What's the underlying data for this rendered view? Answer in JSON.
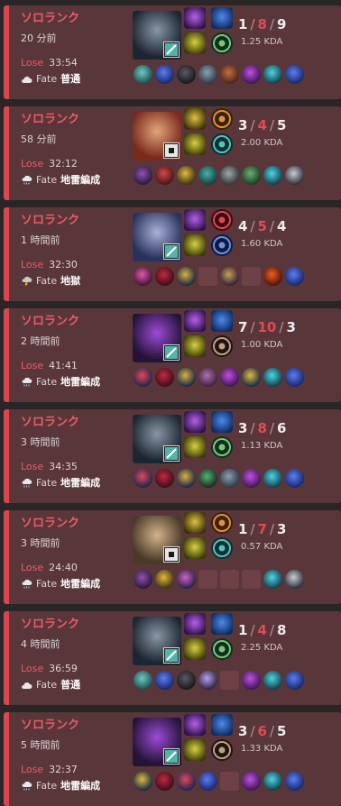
{
  "matches": [
    {
      "queue": "ソロランク",
      "ago": "20 分前",
      "result": "Lose",
      "duration": "33:54",
      "fate_label": "Fate",
      "fate": "普通",
      "weather": "cloud-icon",
      "k": "1",
      "d": "8",
      "a": "9",
      "kda": "1.25 KDA",
      "champ": "dark",
      "badge": "slash",
      "items": [
        "spiral-teal",
        "blue-orb",
        "black",
        "slate",
        "brown",
        "purple",
        "teal-orb",
        "blue-orb"
      ]
    },
    {
      "queue": "ソロランク",
      "ago": "58 分前",
      "result": "Lose",
      "duration": "32:12",
      "fate_label": "Fate",
      "fate": "地雷編成",
      "weather": "cloud-rain-icon",
      "k": "3",
      "d": "4",
      "a": "5",
      "kda": "2.00 KDA",
      "champ": "red",
      "badge": "square",
      "items": [
        "purple-blade",
        "red-bow",
        "gold",
        "teal",
        "steel",
        "green",
        "teal-orb",
        "silver"
      ]
    },
    {
      "queue": "ソロランク",
      "ago": "1 時間前",
      "result": "Lose",
      "duration": "32:30",
      "fate_label": "Fate",
      "fate": "地獄",
      "weather": "storm-icon",
      "k": "4",
      "d": "5",
      "a": "4",
      "kda": "1.60 KDA",
      "champ": "blue",
      "badge": "slash",
      "items": [
        "pink",
        "crimson",
        "gold-blue",
        "empty",
        "purple-gold",
        "empty",
        "fire",
        "blue-orb"
      ]
    },
    {
      "queue": "ソロランク",
      "ago": "2 時間前",
      "result": "Lose",
      "duration": "41:41",
      "fate_label": "Fate",
      "fate": "地雷編成",
      "weather": "cloud-rain-icon",
      "k": "7",
      "d": "10",
      "a": "3",
      "kda": "1.00 KDA",
      "champ": "violet",
      "badge": "slash",
      "items": [
        "blue-red",
        "crimson",
        "gold-blue",
        "mauve",
        "purple",
        "blue-gold",
        "teal-orb",
        "blue-orb"
      ]
    },
    {
      "queue": "ソロランク",
      "ago": "3 時間前",
      "result": "Lose",
      "duration": "34:35",
      "fate_label": "Fate",
      "fate": "地雷編成",
      "weather": "cloud-rain-icon",
      "k": "3",
      "d": "8",
      "a": "6",
      "kda": "1.13 KDA",
      "champ": "dark",
      "badge": "slash",
      "items": [
        "blue-red",
        "crimson",
        "gold-blue",
        "green-ring",
        "slate",
        "purple",
        "teal-orb",
        "blue-orb"
      ]
    },
    {
      "queue": "ソロランク",
      "ago": "3 時間前",
      "result": "Lose",
      "duration": "24:40",
      "fate_label": "Fate",
      "fate": "地雷編成",
      "weather": "cloud-rain-icon",
      "k": "1",
      "d": "7",
      "a": "3",
      "kda": "0.57 KDA",
      "champ": "gold",
      "badge": "square",
      "items": [
        "purple-blade",
        "gold",
        "pink-blue",
        "empty",
        "empty",
        "empty",
        "teal-orb",
        "silver"
      ]
    },
    {
      "queue": "ソロランク",
      "ago": "4 時間前",
      "result": "Lose",
      "duration": "36:59",
      "fate_label": "Fate",
      "fate": "普通",
      "weather": "cloud-icon",
      "k": "1",
      "d": "4",
      "a": "8",
      "kda": "2.25 KDA",
      "champ": "dark",
      "badge": "slash",
      "items": [
        "spiral-teal",
        "blue-orb",
        "black",
        "lilac",
        "empty",
        "purple",
        "teal-orb",
        "blue-orb"
      ]
    },
    {
      "queue": "ソロランク",
      "ago": "5 時間前",
      "result": "Lose",
      "duration": "32:37",
      "fate_label": "Fate",
      "fate": "地雷編成",
      "weather": "cloud-rain-icon",
      "k": "3",
      "d": "6",
      "a": "5",
      "kda": "1.33 KDA",
      "champ": "violet",
      "badge": "slash",
      "items": [
        "blue-gold",
        "crimson",
        "blue-red",
        "blue-orb",
        "empty",
        "purple",
        "teal-orb",
        "blue-orb"
      ]
    }
  ],
  "spell_keystones": [
    "arcane-comet",
    "predator",
    "grasp",
    "electrocute",
    "dark-harvest",
    "aery",
    "arcane-comet",
    "dark-harvest"
  ],
  "spells": [
    [
      "purple-spell",
      "blue-spell",
      "yellow-spell",
      "green-rune"
    ],
    [
      "gold-spell",
      "orange-rune",
      "yellow-spell",
      "teal-rune"
    ],
    [
      "purple-spell",
      "red-rune",
      "yellow-spell",
      "blue-rune"
    ],
    [
      "purple-spell",
      "blue-spell",
      "yellow-spell",
      "dark-rune"
    ],
    [
      "purple-spell",
      "blue-spell",
      "yellow-spell",
      "green-rune"
    ],
    [
      "gold-spell",
      "orange-rune",
      "yellow-spell",
      "teal-rune"
    ],
    [
      "purple-spell",
      "blue-spell",
      "yellow-spell",
      "green-rune"
    ],
    [
      "purple-spell",
      "blue-spell",
      "yellow-spell",
      "dark-rune"
    ]
  ]
}
